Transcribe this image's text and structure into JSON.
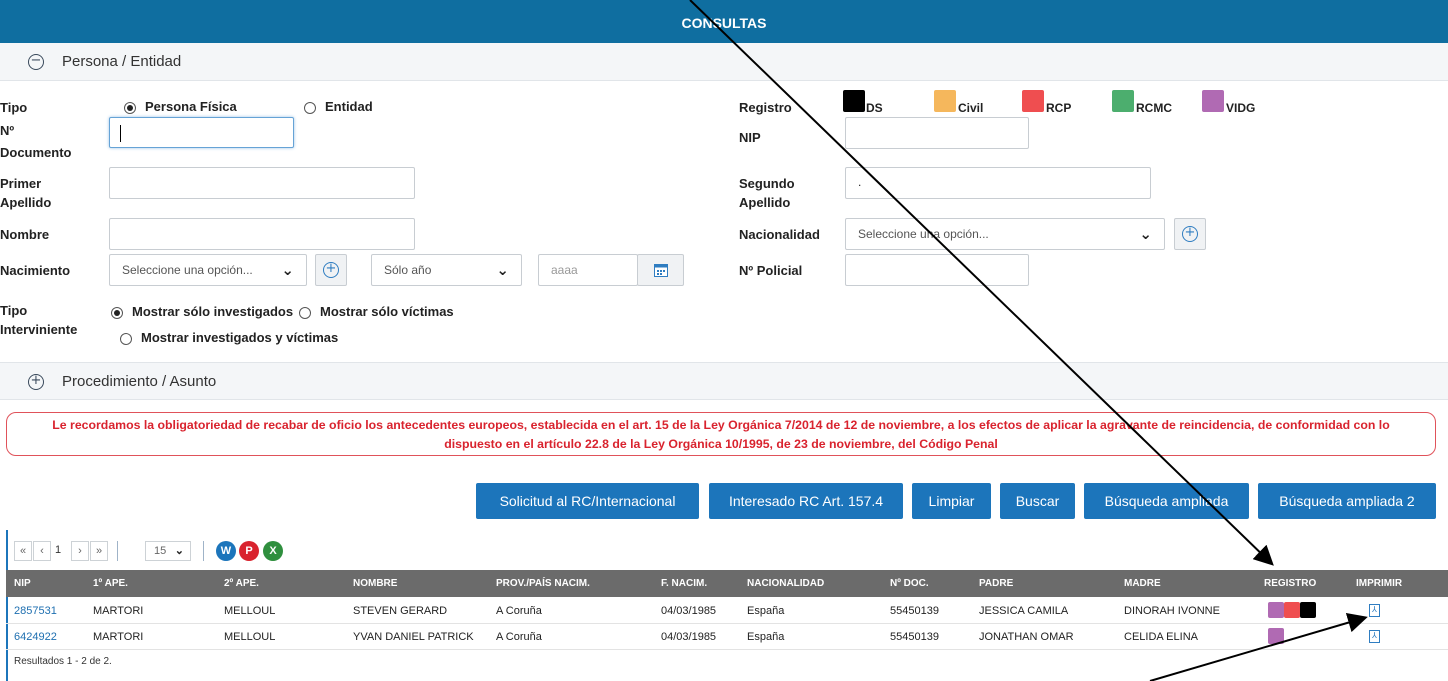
{
  "header": {
    "title": "CONSULTAS"
  },
  "sections": {
    "persona": {
      "label": "Persona / Entidad",
      "toggle": "−"
    },
    "procedimiento": {
      "label": "Procedimiento / Asunto",
      "toggle": "+"
    }
  },
  "form": {
    "tipo": {
      "label": "Tipo",
      "opt1": "Persona Física",
      "opt2": "Entidad",
      "selected": "Persona Física"
    },
    "documento": {
      "label_l1": "Nº",
      "label_l2": "Documento",
      "value": ""
    },
    "primer_apellido": {
      "label_l1": "Primer",
      "label_l2": "Apellido",
      "value": ""
    },
    "nombre": {
      "label": "Nombre",
      "value": ""
    },
    "nacimiento": {
      "label": "Nacimiento",
      "select_placeholder": "Seleccione una opción...",
      "year_mode": "Sólo año",
      "year_placeholder": "aaaa"
    },
    "tipo_interviniente": {
      "label_l1": "Tipo",
      "label_l2": "Interviniente",
      "opt1": "Mostrar sólo investigados",
      "opt2": "Mostrar sólo víctimas",
      "opt3": "Mostrar investigados y víctimas"
    },
    "registro": {
      "label": "Registro",
      "items": [
        {
          "name": "DS",
          "color": "#000000"
        },
        {
          "name": "Civil",
          "color": "#f5b75c"
        },
        {
          "name": "RCP",
          "color": "#ef4e50"
        },
        {
          "name": "RCMC",
          "color": "#4cae6e"
        },
        {
          "name": "VIDG",
          "color": "#b06ab3"
        }
      ]
    },
    "nip": {
      "label": "NIP",
      "value": ""
    },
    "segundo_apellido": {
      "label_l1": "Segundo",
      "label_l2": "Apellido",
      "value": "."
    },
    "nacionalidad": {
      "label": "Nacionalidad",
      "placeholder": "Seleccione una opción..."
    },
    "policial": {
      "label": "Nº Policial",
      "value": ""
    }
  },
  "notice": {
    "line1": "Le recordamos la obligatoriedad de recabar de oficio los antecedentes europeos, establecida en el art. 15 de la Ley Orgánica 7/2014 de 12 de noviembre, a los efectos de aplicar la agravante de reincidencia, de conformidad con lo",
    "line2": "dispuesto en el artículo 22.8 de la Ley Orgánica 10/1995, de 23 de noviembre, del Código Penal"
  },
  "buttons": {
    "solicitud": "Solicitud al RC/Internacional",
    "interesado": "Interesado RC Art. 157.4",
    "limpiar": "Limpiar",
    "buscar": "Buscar",
    "ampliada": "Búsqueda ampliada",
    "ampliada2": "Búsqueda ampliada 2"
  },
  "pager": {
    "first": "«",
    "prev": "‹",
    "page": "1",
    "next": "›",
    "last": "»",
    "page_size": "15"
  },
  "table": {
    "headers": [
      "NIP",
      "1º APE.",
      "2º APE.",
      "NOMBRE",
      "PROV./PAÍS NACIM.",
      "F. NACIM.",
      "NACIONALIDAD",
      "Nº DOC.",
      "PADRE",
      "MADRE",
      "REGISTRO",
      "IMPRIMIR"
    ],
    "rows": [
      {
        "nip": "2857531",
        "ape1": "MARTORI",
        "ape2": "MELLOUL",
        "nombre": "STEVEN GERARD",
        "prov": "A Coruña",
        "fnac": "04/03/1985",
        "nac": "España",
        "doc": "55450139",
        "padre": "JESSICA CAMILA",
        "madre": "DINORAH IVONNE",
        "registro": [
          "#b06ab3",
          "#ef4e50",
          "#000000"
        ]
      },
      {
        "nip": "6424922",
        "ape1": "MARTORI",
        "ape2": "MELLOUL",
        "nombre": "YVAN DANIEL PATRICK",
        "prov": "A Coruña",
        "fnac": "04/03/1985",
        "nac": "España",
        "doc": "55450139",
        "padre": "JONATHAN OMAR",
        "madre": "CELIDA ELINA",
        "registro": [
          "#b06ab3"
        ]
      }
    ],
    "results": "Resultados 1 - 2 de 2."
  }
}
